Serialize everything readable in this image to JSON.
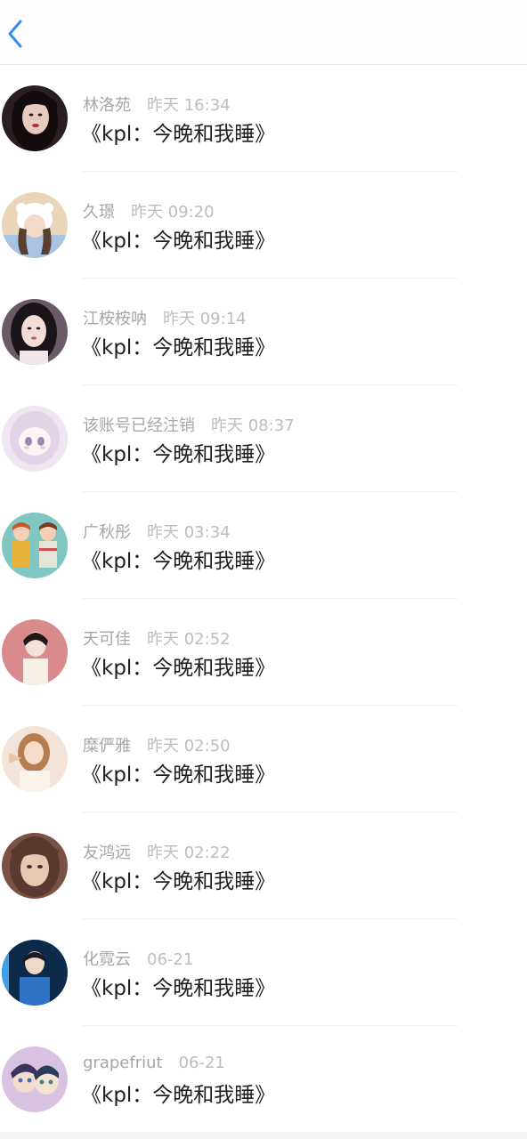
{
  "header": {
    "back_icon": "chevron-left-icon",
    "accent": "#2f8ff0"
  },
  "items": [
    {
      "name": "林洛苑",
      "time": "昨天 16:34",
      "message": "《kpl：今晚和我睡》"
    },
    {
      "name": "久璟",
      "time": "昨天 09:20",
      "message": "《kpl：今晚和我睡》"
    },
    {
      "name": "江桉桉呐",
      "time": "昨天 09:14",
      "message": "《kpl：今晚和我睡》"
    },
    {
      "name": "该账号已经注销",
      "time": "昨天 08:37",
      "message": "《kpl：今晚和我睡》"
    },
    {
      "name": "广秋彤",
      "time": "昨天 03:34",
      "message": "《kpl：今晚和我睡》"
    },
    {
      "name": "天可佳",
      "time": "昨天 02:52",
      "message": "《kpl：今晚和我睡》"
    },
    {
      "name": "糜俨雅",
      "time": "昨天 02:50",
      "message": "《kpl：今晚和我睡》"
    },
    {
      "name": "友鸿远",
      "time": "昨天 02:22",
      "message": "《kpl：今晚和我睡》"
    },
    {
      "name": "化霓云",
      "time": "06-21",
      "message": "《kpl：今晚和我睡》"
    },
    {
      "name": "grapefriut",
      "time": "06-21",
      "message": "《kpl：今晚和我睡》"
    }
  ]
}
